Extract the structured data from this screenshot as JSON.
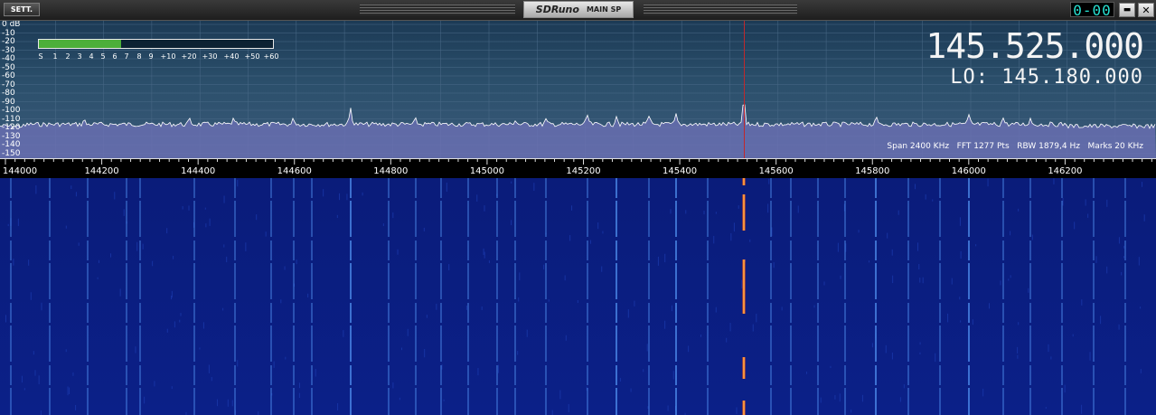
{
  "titlebar": {
    "sett_label": "SETT.",
    "app_name": "SDRuno",
    "panel_name": "MAIN SP",
    "vfo_indicator": "0-00",
    "minimize_icon": "minimize-icon",
    "close_icon": "close-icon",
    "minimize_glyph": "▬",
    "close_glyph": "✕"
  },
  "spectrum": {
    "db_labels": [
      "0  dB",
      "-10",
      "-20",
      "-30",
      "-40",
      "-50",
      "-60",
      "-70",
      "-80",
      "-90",
      "-100",
      "-110",
      "-120",
      "-130",
      "-140",
      "-150"
    ],
    "meter_labels": [
      "S",
      "1",
      "2",
      "3",
      "4",
      "5",
      "6",
      "7",
      "8",
      "9",
      "+10",
      "+20",
      "+30",
      "+40",
      "+50",
      "+60"
    ],
    "meter_level_fraction": 0.35,
    "frequency": "145.525.000",
    "lo": "LO: 145.180.000",
    "span": "Span 2400 KHz",
    "fft": "FFT 1277 Pts",
    "rbw": "RBW 1879,4 Hz",
    "marks": "Marks 20 KHz",
    "colors": {
      "trace": "#ffffff",
      "fill": "#6f72b8",
      "marker": "#c0282c",
      "meter": "#4caf3a"
    }
  },
  "axis": {
    "labels": [
      "144000",
      "144200",
      "144400",
      "144600",
      "144800",
      "145000",
      "145200",
      "145400",
      "145600",
      "145800",
      "146000",
      "146200"
    ]
  },
  "waterfall": {
    "colors": {
      "background": "#0b1f85",
      "trace": "#5aa0ff",
      "signal": "#ff5a1a"
    }
  }
}
